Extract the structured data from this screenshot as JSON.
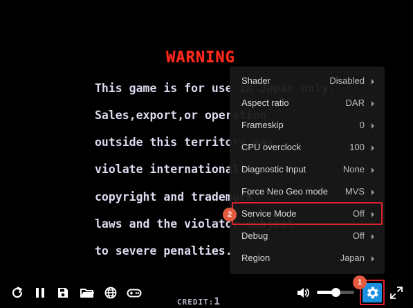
{
  "game": {
    "warning_title": "WARNING",
    "lines": [
      "This game is for use in Japan only.",
      "Sales,export,or operation",
      "outside this territory may",
      "violate international",
      "copyright and trademark",
      "laws and the violator subject",
      "to severe penalties."
    ],
    "credit_label": "CREDIT:",
    "credit_value": "1"
  },
  "settings_menu": {
    "items": [
      {
        "label": "Shader",
        "value": "Disabled"
      },
      {
        "label": "Aspect ratio",
        "value": "DAR"
      },
      {
        "label": "Frameskip",
        "value": "0"
      },
      {
        "label": "CPU overclock",
        "value": "100"
      },
      {
        "label": "Diagnostic Input",
        "value": "None"
      },
      {
        "label": "Force Neo Geo mode",
        "value": "MVS"
      },
      {
        "label": "Service Mode",
        "value": "Off"
      },
      {
        "label": "Debug",
        "value": "Off"
      },
      {
        "label": "Region",
        "value": "Japan"
      }
    ],
    "highlighted_item": "Service Mode"
  },
  "annotations": {
    "step1": "1",
    "step2": "2",
    "highlight_color": "#e0202e",
    "badge_color": "#e35a3f"
  },
  "toolbar": {
    "icons": [
      "restart-icon",
      "pause-icon",
      "save-icon",
      "folder-icon",
      "globe-icon",
      "gamepad-icon",
      "volume-icon",
      "gear-icon",
      "fullscreen-icon"
    ],
    "volume_level": 0.5,
    "settings_accent": "#1c8fe0"
  }
}
